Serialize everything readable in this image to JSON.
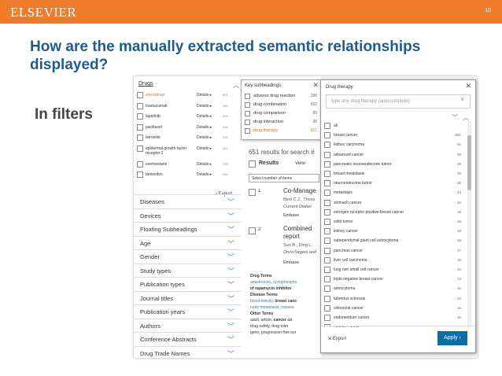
{
  "header": {
    "brand": "ELSEVIER",
    "page_number": "10"
  },
  "slide": {
    "title": "How are the manually extracted semantic relationships displayed?",
    "subtitle": "In filters"
  },
  "filters": {
    "drugs_heading": "Drugs",
    "drugs": [
      {
        "name": "everolimus",
        "details": "Details ▸",
        "count": "651",
        "selected": true
      },
      {
        "name": "trastuzumab",
        "details": "Details ▸",
        "count": "469"
      },
      {
        "name": "lapatinib",
        "details": "Details ▸",
        "count": "302"
      },
      {
        "name": "paclitaxel",
        "details": "Details ▸",
        "count": "296"
      },
      {
        "name": "letrozole",
        "details": "Details ▸",
        "count": "290"
      },
      {
        "name": "epidermal growth factor receptor 2",
        "details": "Details ▸",
        "count": "281"
      },
      {
        "name": "exemestane",
        "details": "Details ▸",
        "count": "259"
      },
      {
        "name": "tamoxifen",
        "details": "Details ▸",
        "count": "252"
      }
    ],
    "export": "Export",
    "facets": [
      "Diseases",
      "Devices",
      "Floating Subheadings",
      "Age",
      "Gender",
      "Study types",
      "Publication types",
      "Journal titles",
      "Publication years",
      "Authors",
      "Conference Abstracts",
      "Drug Trade Names"
    ]
  },
  "key_subheadings": {
    "title": "Key subheadings",
    "items": [
      {
        "label": "adverse drug reaction",
        "count": "186"
      },
      {
        "label": "drug combination",
        "count": "422"
      },
      {
        "label": "drug comparison",
        "count": "83"
      },
      {
        "label": "drug interaction",
        "count": "38"
      },
      {
        "label": "drug therapy",
        "count": "651",
        "selected": true
      }
    ]
  },
  "results": {
    "count_text": "651 results for search #",
    "results_label": "Results",
    "view_label": "View",
    "select_label": "Select number of items",
    "items": [
      {
        "number": "1",
        "title": "Co-Manage",
        "authors": "Best C.J., Thoss",
        "source": "Current Diabet",
        "link": "Embase"
      },
      {
        "number": "2",
        "title": "Combined report",
        "authors": "Sun B., Ding L.",
        "source": "OncoTargets and",
        "link": "Embase"
      }
    ],
    "drug_terms_heading": "Drug Terms",
    "drug_terms": [
      "anastrozole",
      "cyclophospha",
      "of rapamycin inhibitor"
    ],
    "disease_terms_heading": "Disease Terms",
    "disease_terms": [
      "blood toxicity",
      "breast canc",
      "node metastasis",
      "nausea"
    ],
    "other_terms_heading": "Other Terms",
    "other_terms": [
      "adult",
      "article",
      "cancer co",
      "drug safety",
      "drug toler",
      "gene",
      "progression free sur"
    ]
  },
  "drug_therapy": {
    "title": "Drug therapy",
    "placeholder": "type any drug therapy (autocomplete)",
    "clear": "x",
    "items": [
      {
        "label": "all",
        "count": ""
      },
      {
        "label": "breast cancer",
        "count": "651"
      },
      {
        "label": "kidney carcinoma",
        "count": "64"
      },
      {
        "label": "advanced cancer",
        "count": "63"
      },
      {
        "label": "pancreatic neuroendocrine tumor",
        "count": "29"
      },
      {
        "label": "breast metastasis",
        "count": "26"
      },
      {
        "label": "neuroendocrine tumor",
        "count": "25"
      },
      {
        "label": "metastasis",
        "count": "24"
      },
      {
        "label": "stomach cancer",
        "count": "22"
      },
      {
        "label": "estrogen receptor positive breast cancer",
        "count": "19"
      },
      {
        "label": "solid tumor",
        "count": "19"
      },
      {
        "label": "kidney cancer",
        "count": "18"
      },
      {
        "label": "subependymal giant cell astrocytoma",
        "count": "18"
      },
      {
        "label": "pancreas cancer",
        "count": "17"
      },
      {
        "label": "liver cell carcinoma",
        "count": "16"
      },
      {
        "label": "lung non small cell cancer",
        "count": "13"
      },
      {
        "label": "triple negative breast cancer",
        "count": "13"
      },
      {
        "label": "astrocytoma",
        "count": "12"
      },
      {
        "label": "tuberous sclerosis",
        "count": "12"
      },
      {
        "label": "colorectal cancer",
        "count": "10"
      },
      {
        "label": "endometrium cancer",
        "count": "10"
      },
      {
        "label": "ovarian cancer",
        "count": ""
      }
    ],
    "export": "Export",
    "apply": "Apply ›"
  },
  "colors": {
    "brand": "#f07b2a",
    "title": "#1f5b8e",
    "link": "#2d7fb5",
    "highlight": "#e9711c",
    "button": "#0b6fa6"
  }
}
